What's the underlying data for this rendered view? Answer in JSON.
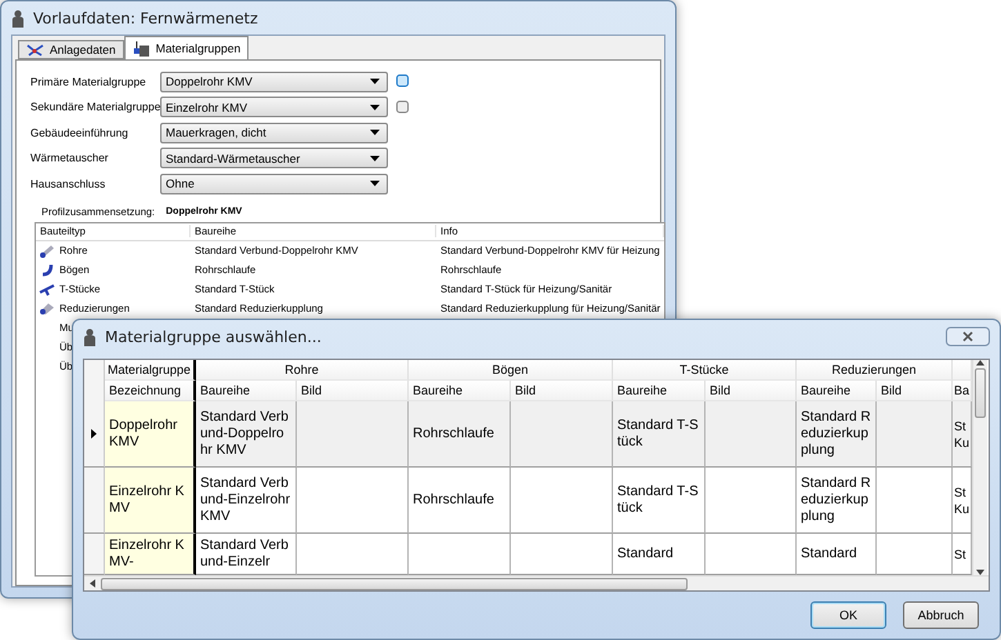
{
  "main_window": {
    "title": "Vorlaufdaten: Fernwärmenetz",
    "tabs": [
      {
        "label": "Anlagedaten",
        "selected": false,
        "kind": "network"
      },
      {
        "label": "Materialgruppen",
        "selected": true,
        "kind": "material"
      }
    ],
    "form": [
      {
        "label": "Primäre Materialgruppe",
        "value": "Doppelrohr KMV",
        "picker_active": true
      },
      {
        "label": "Sekundäre Materialgruppe",
        "value": "Einzelrohr KMV",
        "picker_active": false
      },
      {
        "label": "Gebäudeeinführung",
        "value": "Mauerkragen, dicht"
      },
      {
        "label": "Wärmetauscher",
        "value": "Standard-Wärmetauscher"
      },
      {
        "label": "Hausanschluss",
        "value": "Ohne"
      }
    ],
    "profile": {
      "label": "Profilzusammensetzung:",
      "value": "Doppelrohr KMV"
    },
    "parts_list": {
      "columns": [
        "Bauteiltyp",
        "Baureihe",
        "Info"
      ],
      "rows": [
        {
          "kind": "pipe",
          "cells": [
            "Rohre",
            "Standard Verbund-Doppelrohr KMV",
            "Standard Verbund-Doppelrohr KMV für Heizung"
          ]
        },
        {
          "kind": "bend",
          "cells": [
            "Bögen",
            "Rohrschlaufe",
            "Rohrschlaufe"
          ]
        },
        {
          "kind": "tee",
          "cells": [
            "T-Stücke",
            "Standard  T-Stück",
            "Standard  T-Stück  für Heizung/Sanitär"
          ]
        },
        {
          "kind": "reducer",
          "cells": [
            "Reduzierungen",
            "Standard  Reduzierkupplung",
            "Standard  Reduzierkupplung für Heizung/Sanitär"
          ]
        },
        {
          "cells": [
            "Mu"
          ]
        },
        {
          "cells": [
            "Üb"
          ]
        },
        {
          "cells": [
            "Üb"
          ]
        }
      ]
    }
  },
  "dialog": {
    "title": "Materialgruppe auswählen...",
    "groups": [
      {
        "label": "Materialgruppe",
        "columns": [
          "Bezeichnung"
        ]
      },
      {
        "label": "Rohre",
        "columns": [
          "Baureihe",
          "Bild"
        ]
      },
      {
        "label": "Bögen",
        "columns": [
          "Baureihe",
          "Bild"
        ]
      },
      {
        "label": "T-Stücke",
        "columns": [
          "Baureihe",
          "Bild"
        ]
      },
      {
        "label": "Reduzierungen",
        "columns": [
          "Baureihe",
          "Bild"
        ]
      },
      {
        "columns": [
          "Ba"
        ]
      }
    ],
    "rows": [
      {
        "selected": true,
        "cells": [
          "Doppelrohr KMV",
          "Standard Verbund-Doppelrohr KMV",
          "",
          "Rohrschlaufe",
          "",
          "Standard T-Stück",
          "",
          "Standard Reduzierkupplung",
          "",
          "St Ku"
        ]
      },
      {
        "selected": false,
        "cells": [
          "Einzelrohr KMV",
          "Standard Verbund-Einzelrohr KMV",
          "",
          "Rohrschlaufe",
          "",
          "Standard T-Stück",
          "",
          "Standard Reduzierkupplung",
          "",
          "St Ku"
        ]
      },
      {
        "selected": false,
        "cells": [
          "Einzelrohr KMV-",
          "Standard Verbund-Einzelr",
          "",
          "",
          "",
          "Standard",
          "",
          "Standard",
          "",
          "St"
        ]
      }
    ],
    "buttons": [
      {
        "label": "OK",
        "default": true
      },
      {
        "label": "Abbruch",
        "default": false
      }
    ]
  }
}
